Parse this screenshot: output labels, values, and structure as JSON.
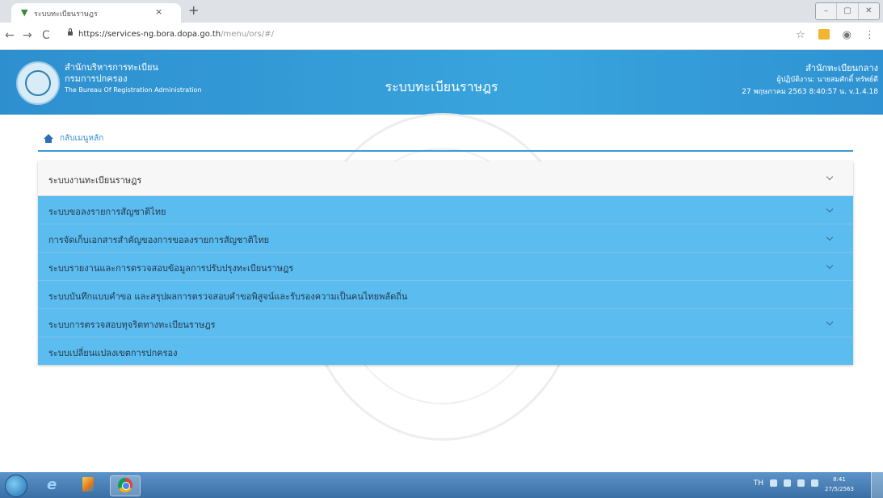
{
  "browser": {
    "tab_title": "ระบบทะเบียนราษฎร",
    "tab_close": "×",
    "new_tab": "+",
    "url_base": "https://services-ng.bora.dopa.go.th",
    "url_path": "/menu/ors/#/",
    "window_controls": [
      "–",
      "▢",
      "✕"
    ]
  },
  "header": {
    "org_line1": "สำนักบริหารการทะเบียน",
    "org_line2": "กรมการปกครอง",
    "org_en": "The Bureau Of Registration Administration",
    "system_title": "ระบบทะเบียนราษฎร",
    "office": "สำนักทะเบียนกลาง",
    "user": "ผู้ปฏิบัติงาน: นายสมศักดิ์ ทรัพย์ดี",
    "datetime": "27 พฤษภาคม 2563 8:40:57 น.  v.1.4.18"
  },
  "breadcrumb": {
    "label": "กลับเมนูหลัก"
  },
  "menu": {
    "items": [
      {
        "label": "ระบบงานทะเบียนราษฎร",
        "has_chevron": true
      },
      {
        "label": "ระบบขอลงรายการสัญชาติไทย",
        "has_chevron": true
      },
      {
        "label": "การจัดเก็บเอกสารสำคัญของการขอลงรายการสัญชาติไทย",
        "has_chevron": true
      },
      {
        "label": "ระบบรายงานและการตรวจสอบข้อมูลการปรับปรุงทะเบียนราษฎร",
        "has_chevron": true
      },
      {
        "label": "ระบบบันทึกแบบคำขอ และสรุปผลการตรวจสอบคำขอพิสูจน์และรับรองความเป็นคนไทยพลัดถิ่น",
        "has_chevron": false
      },
      {
        "label": "ระบบการตรวจสอบทุจริตทางทะเบียนราษฎร",
        "has_chevron": true
      },
      {
        "label": "ระบบเปลี่ยนแปลงเขตการปกครอง",
        "has_chevron": false
      }
    ]
  },
  "taskbar": {
    "tray_lang": "TH",
    "clock_time": "8:41",
    "clock_date": "27/5/2563"
  },
  "colors": {
    "header_blue": "#38a4dd",
    "menu_blue": "#5bbcf0",
    "divider_blue": "#3c9ad8"
  }
}
